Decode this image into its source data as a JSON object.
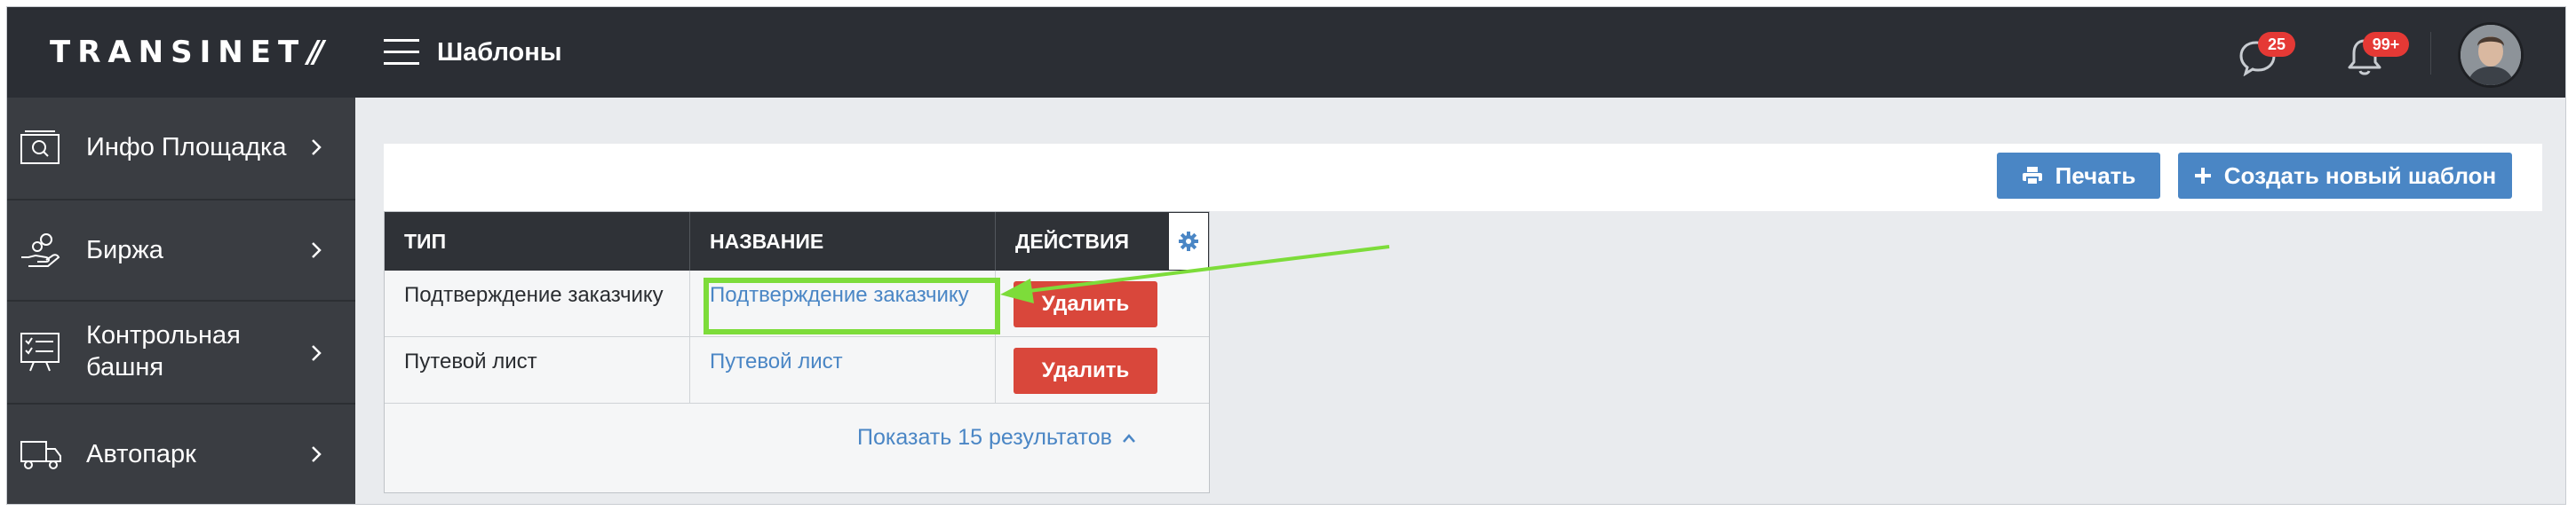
{
  "header": {
    "logo_text": "TRANSINET",
    "logo_mark": "//",
    "title": "Шаблоны",
    "messages_badge": "25",
    "notifications_badge": "99+"
  },
  "sidebar": {
    "items": [
      {
        "label": "Инфо Площадка",
        "icon": "search-card-icon"
      },
      {
        "label": "Биржа",
        "icon": "hand-coins-icon"
      },
      {
        "label": "Контрольная башня",
        "icon": "checklist-board-icon"
      },
      {
        "label": "Автопарк",
        "icon": "truck-icon"
      }
    ]
  },
  "toolbar": {
    "print_label": "Печать",
    "create_label": "Создать новый шаблон"
  },
  "table": {
    "columns": [
      "ТИП",
      "НАЗВАНИЕ",
      "ДЕЙСТВИЯ"
    ],
    "rows": [
      {
        "type": "Подтверждение заказчику",
        "name": "Подтверждение заказчику",
        "action": "Удалить"
      },
      {
        "type": "Путевой лист",
        "name": "Путевой лист",
        "action": "Удалить"
      }
    ],
    "show_more": "Показать 15 результатов"
  },
  "colors": {
    "accent": "#4a86c5",
    "danger": "#d9473b",
    "highlight": "#7ddc3a",
    "topbar": "#2b2e34",
    "sidebar": "#3a3d42"
  }
}
